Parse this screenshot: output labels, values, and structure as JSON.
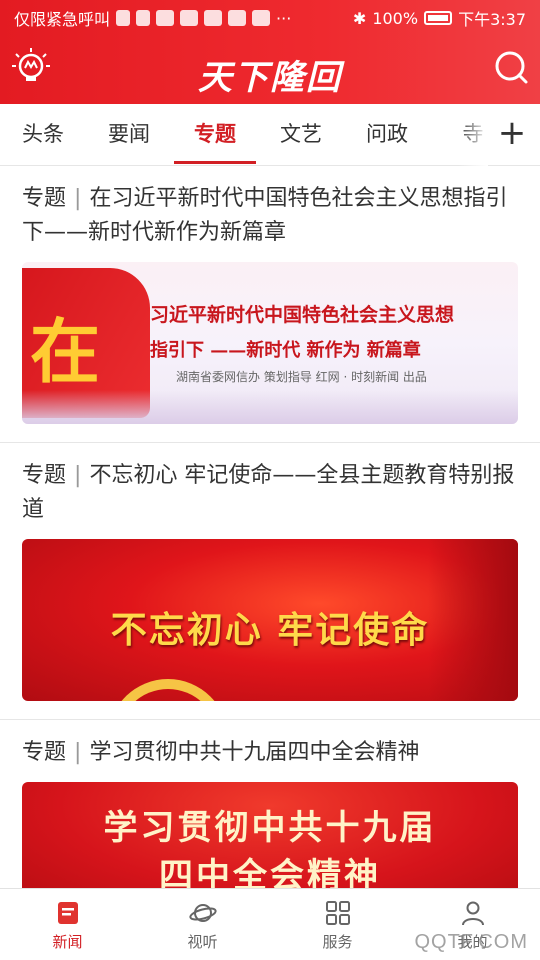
{
  "status_bar": {
    "carrier": "仅限紧急呼叫",
    "overflow": "···",
    "battery": "100%",
    "time": "下午3:37"
  },
  "app": {
    "logo": "天下隆回"
  },
  "tabs": [
    {
      "label": "头条"
    },
    {
      "label": "要闻"
    },
    {
      "label": "专题",
      "active": true
    },
    {
      "label": "文艺"
    },
    {
      "label": "问政"
    },
    {
      "label": "寺"
    }
  ],
  "tab_add": "+",
  "feed": {
    "items": [
      {
        "tag": "专题",
        "sep": "|",
        "title": "在习近平新时代中国特色社会主义思想指引下——新时代新作为新篇章",
        "banner": {
          "big_char": "在",
          "line1": "习近平新时代中国特色社会主义思想",
          "line2": "指引下 ——新时代 新作为 新篇章",
          "line3": "湖南省委网信办  策划指导    红网 · 时刻新闻  出品"
        }
      },
      {
        "tag": "专题",
        "sep": "|",
        "title": "不忘初心  牢记使命——全县主题教育特别报道",
        "banner": {
          "text": "不忘初心  牢记使命"
        }
      },
      {
        "tag": "专题",
        "sep": "|",
        "title": "学习贯彻中共十九届四中全会精神",
        "banner": {
          "line1": "学习贯彻中共十九届",
          "line2": "四中全会精神"
        }
      }
    ]
  },
  "bottom_nav": [
    {
      "label": "新闻",
      "icon": "news-icon",
      "active": true
    },
    {
      "label": "视听",
      "icon": "planet-icon"
    },
    {
      "label": "服务",
      "icon": "grid-icon"
    },
    {
      "label": "我的",
      "icon": "user-icon"
    }
  ],
  "watermark": "QQTF.COM",
  "colors": {
    "brand_red": "#e31b22",
    "active_tab": "#d21f24"
  }
}
